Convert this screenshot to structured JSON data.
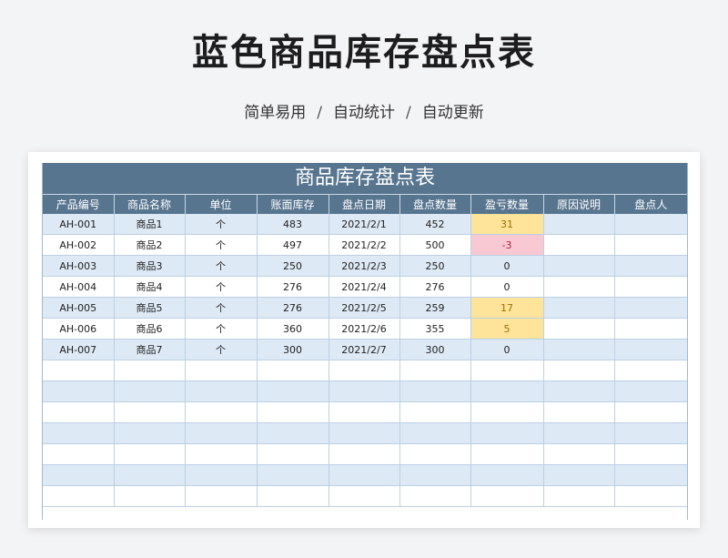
{
  "page": {
    "title": "蓝色商品库存盘点表",
    "subtitle_parts": [
      "简单易用",
      "自动统计",
      "自动更新"
    ],
    "separator": "/"
  },
  "sheet": {
    "title": "商品库存盘点表",
    "headers": [
      "产品编号",
      "商品名称",
      "单位",
      "账面库存",
      "盘点日期",
      "盘点数量",
      "盈亏数量",
      "原因说明",
      "盘点人"
    ],
    "rows": [
      [
        "AH-001",
        "商品1",
        "个",
        "483",
        "2021/2/1",
        "452",
        "31",
        "",
        ""
      ],
      [
        "AH-002",
        "商品2",
        "个",
        "497",
        "2021/2/2",
        "500",
        "-3",
        "",
        ""
      ],
      [
        "AH-003",
        "商品3",
        "个",
        "250",
        "2021/2/3",
        "250",
        "0",
        "",
        ""
      ],
      [
        "AH-004",
        "商品4",
        "个",
        "276",
        "2021/2/4",
        "276",
        "0",
        "",
        ""
      ],
      [
        "AH-005",
        "商品5",
        "个",
        "276",
        "2021/2/5",
        "259",
        "17",
        "",
        ""
      ],
      [
        "AH-006",
        "商品6",
        "个",
        "360",
        "2021/2/6",
        "355",
        "5",
        "",
        ""
      ],
      [
        "AH-007",
        "商品7",
        "个",
        "300",
        "2021/2/7",
        "300",
        "0",
        "",
        ""
      ],
      [
        "",
        "",
        "",
        "",
        "",
        "",
        "",
        "",
        ""
      ],
      [
        "",
        "",
        "",
        "",
        "",
        "",
        "",
        "",
        ""
      ],
      [
        "",
        "",
        "",
        "",
        "",
        "",
        "",
        "",
        ""
      ],
      [
        "",
        "",
        "",
        "",
        "",
        "",
        "",
        "",
        ""
      ],
      [
        "",
        "",
        "",
        "",
        "",
        "",
        "",
        "",
        ""
      ],
      [
        "",
        "",
        "",
        "",
        "",
        "",
        "",
        "",
        ""
      ],
      [
        "",
        "",
        "",
        "",
        "",
        "",
        "",
        "",
        ""
      ]
    ],
    "colors": {
      "header_bg": "#58758f",
      "row_alt_bg": "#dde9f5",
      "positive_highlight": "#fde49a",
      "negative_highlight": "#f8c9d2"
    }
  }
}
